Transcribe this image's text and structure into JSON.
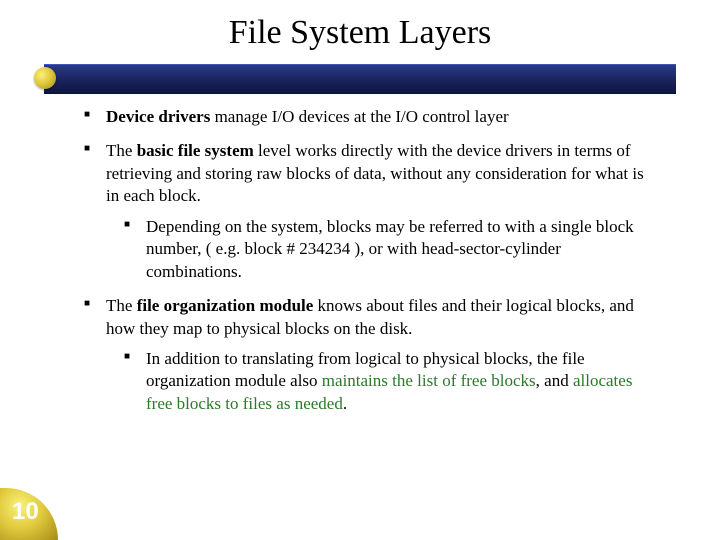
{
  "title": "File System Layers",
  "bullets": {
    "item1": {
      "strong": "Device drivers",
      "rest": " manage I/O devices at the I/O control layer"
    },
    "item2": {
      "pre": "The ",
      "strong": "basic file system",
      "rest": " level works directly with the device drivers in terms of retrieving and storing raw blocks of data, without any consideration for what is in each block.",
      "sub1": "Depending on the system, blocks may be referred to with a single block number, ( e.g. block # 234234 ), or with head-sector-cylinder combinations."
    },
    "item3": {
      "pre": "The ",
      "strong": "file organization module",
      "rest": " knows about files and their logical blocks, and how they map to physical blocks on the disk.",
      "sub1": {
        "pre": "In addition to translating from logical to physical blocks, the file organization module also ",
        "hl1": "maintains the list of free blocks",
        "mid": ", and ",
        "hl2": "allocates free blocks to files as needed",
        "post": "."
      }
    }
  },
  "pageNumber": "10"
}
